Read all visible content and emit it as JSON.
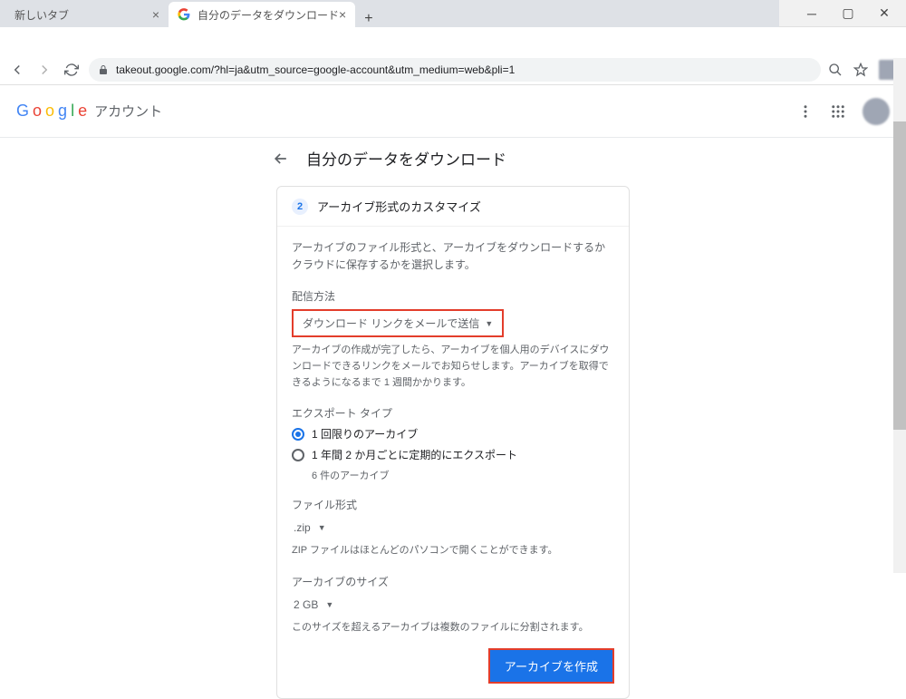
{
  "tabs": [
    {
      "title": "新しいタブ",
      "active": false
    },
    {
      "title": "自分のデータをダウンロード",
      "active": true
    }
  ],
  "url": "takeout.google.com/?hl=ja&utm_source=google-account&utm_medium=web&pli=1",
  "logo": {
    "letters": [
      "G",
      "o",
      "o",
      "g",
      "l",
      "e"
    ],
    "sub": "アカウント"
  },
  "page_title": "自分のデータをダウンロード",
  "card": {
    "step": "2",
    "title": "アーカイブ形式のカスタマイズ",
    "intro": "アーカイブのファイル形式と、アーカイブをダウンロードするかクラウドに保存するかを選択します。",
    "delivery": {
      "label": "配信方法",
      "value": "ダウンロード リンクをメールで送信",
      "desc": "アーカイブの作成が完了したら、アーカイブを個人用のデバイスにダウンロードできるリンクをメールでお知らせします。アーカイブを取得できるようになるまで 1 週間かかります。"
    },
    "export_type": {
      "label": "エクスポート タイプ",
      "opt1": "1 回限りのアーカイブ",
      "opt2": "1 年間 2 か月ごとに定期的にエクスポート",
      "opt2_note": "6 件のアーカイブ"
    },
    "file_format": {
      "label": "ファイル形式",
      "value": ".zip",
      "desc": "ZIP ファイルはほとんどのパソコンで開くことができます。"
    },
    "archive_size": {
      "label": "アーカイブのサイズ",
      "value": "2 GB",
      "desc": "このサイズを超えるアーカイブは複数のファイルに分割されます。"
    },
    "create_btn": "アーカイブを作成"
  }
}
